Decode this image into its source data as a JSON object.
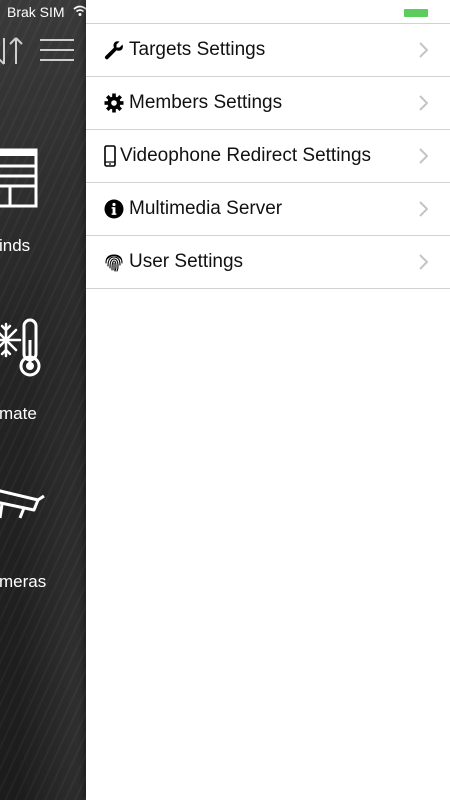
{
  "status_bar": {
    "carrier": "Brak SIM"
  },
  "background_app": {
    "tiles": [
      {
        "label": "inds",
        "icon": "blinds-icon"
      },
      {
        "label": "mate",
        "icon": "climate-icon"
      },
      {
        "label": "meras",
        "icon": "camera-icon"
      }
    ]
  },
  "settings": {
    "items": [
      {
        "label": "Targets Settings",
        "icon": "wrench-icon"
      },
      {
        "label": "Members Settings",
        "icon": "gear-icon"
      },
      {
        "label": "Videophone Redirect Settings",
        "icon": "phone-icon"
      },
      {
        "label": "Multimedia Server",
        "icon": "info-icon"
      },
      {
        "label": "User Settings",
        "icon": "fingerprint-icon"
      }
    ]
  },
  "colors": {
    "battery": "#5ccc5c",
    "divider": "#d2d2d2"
  }
}
